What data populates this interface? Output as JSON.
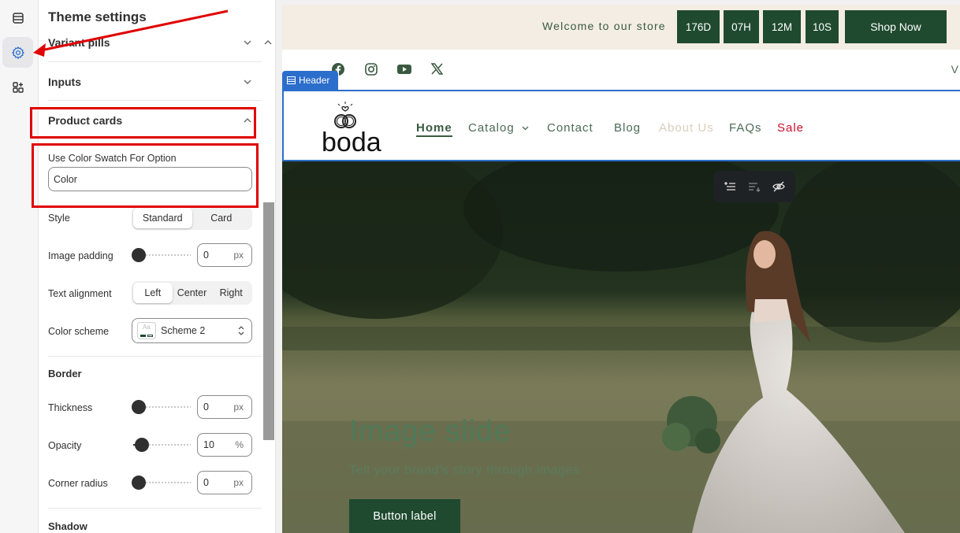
{
  "panel": {
    "title": "Theme settings",
    "sections": {
      "variant_pills": "Variant pills",
      "inputs": "Inputs",
      "product_cards": "Product cards"
    },
    "swatch": {
      "label": "Use Color Swatch For Option",
      "value": "Color"
    },
    "style": {
      "label": "Style",
      "options": [
        "Standard",
        "Card"
      ],
      "selected": "Standard"
    },
    "image_padding": {
      "label": "Image padding",
      "value": "0",
      "unit": "px",
      "level": 0
    },
    "text_alignment": {
      "label": "Text alignment",
      "options": [
        "Left",
        "Center",
        "Right"
      ],
      "selected": "Left"
    },
    "color_scheme": {
      "label": "Color scheme",
      "value": "Scheme 2",
      "swatch_text": "Aa"
    },
    "border": {
      "heading": "Border",
      "thickness": {
        "label": "Thickness",
        "value": "0",
        "unit": "px",
        "level": 0
      },
      "opacity": {
        "label": "Opacity",
        "value": "10",
        "unit": "%",
        "level": 0.1
      },
      "corner_radius": {
        "label": "Corner radius",
        "value": "0",
        "unit": "px",
        "level": 0
      }
    },
    "shadow_heading": "Shadow"
  },
  "preview": {
    "announcement": {
      "text": "Welcome to our store",
      "countdown": [
        "176D",
        "07H",
        "12M",
        "10S"
      ],
      "cta": "Shop Now"
    },
    "social_icons": [
      "facebook-icon",
      "instagram-icon",
      "youtube-icon",
      "x-icon"
    ],
    "cut_text": "V",
    "header_tag": "Header",
    "logo_text": "boda",
    "nav": [
      "Home",
      "Catalog",
      "Contact",
      "Blog",
      "About Us",
      "FAQs",
      "Sale"
    ],
    "hero": {
      "title": "Image slide",
      "subtitle": "Tell your brand's story through images",
      "button": "Button label"
    }
  },
  "colors": {
    "brand_green": "#1f4a2f",
    "announcement_bg": "#f3ede3",
    "selection_blue": "#2c6ecb",
    "annotation_red": "#e00000",
    "sale_red": "#c8102e"
  }
}
